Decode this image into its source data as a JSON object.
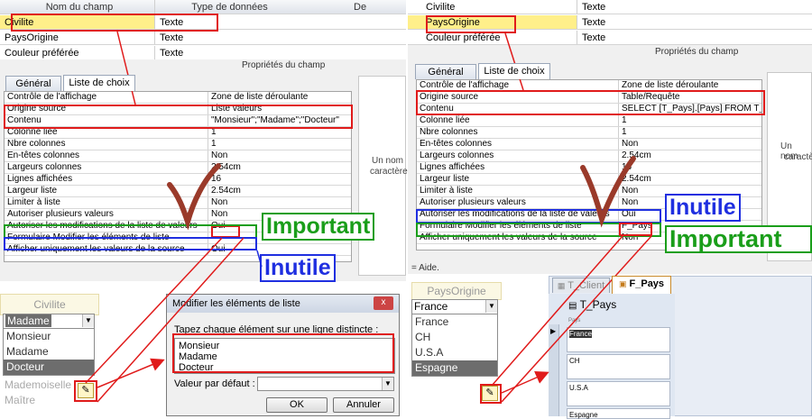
{
  "left_top": {
    "col1": "Nom du champ",
    "col2": "Type de données",
    "col3": "De",
    "rows": [
      {
        "name": "Civilite",
        "type": "Texte"
      },
      {
        "name": "PaysOrigine",
        "type": "Texte"
      },
      {
        "name": "Couleur préférée",
        "type": "Texte"
      }
    ]
  },
  "right_top": {
    "rows": [
      {
        "name": "Civilite",
        "type": "Texte"
      },
      {
        "name": "PaysOrigine",
        "type": "Texte"
      },
      {
        "name": "Couleur préférée",
        "type": "Texte"
      }
    ]
  },
  "props_title": "Propriétés du champ",
  "tabs": {
    "general": "Général",
    "liste": "Liste de choix"
  },
  "left_props": [
    {
      "name": "Contrôle de l'affichage",
      "value": "Zone de liste déroulante"
    },
    {
      "name": "Origine source",
      "value": "Liste valeurs"
    },
    {
      "name": "Contenu",
      "value": "\"Monsieur\";\"Madame\";\"Docteur\""
    },
    {
      "name": "Colonne liée",
      "value": "1"
    },
    {
      "name": "Nbre colonnes",
      "value": "1"
    },
    {
      "name": "En-têtes colonnes",
      "value": "Non"
    },
    {
      "name": "Largeurs colonnes",
      "value": "2.54cm"
    },
    {
      "name": "Lignes affichées",
      "value": "16"
    },
    {
      "name": "Largeur liste",
      "value": "2.54cm"
    },
    {
      "name": "Limiter à liste",
      "value": "Non"
    },
    {
      "name": "Autoriser plusieurs valeurs",
      "value": "Non"
    },
    {
      "name": "Autoriser les modifications de la liste de valeurs",
      "value": "Oui"
    },
    {
      "name": "Formulaire Modifier les éléments de liste",
      "value": ""
    },
    {
      "name": "Afficher uniquement les valeurs de la source",
      "value": "Oui"
    }
  ],
  "right_props": [
    {
      "name": "Contrôle de l'affichage",
      "value": "Zone de liste déroulante"
    },
    {
      "name": "Origine source",
      "value": "Table/Requête"
    },
    {
      "name": "Contenu",
      "value": "SELECT [T_Pays].[Pays] FROM T_Pay"
    },
    {
      "name": "Colonne liée",
      "value": "1"
    },
    {
      "name": "Nbre colonnes",
      "value": "1"
    },
    {
      "name": "En-têtes colonnes",
      "value": "Non"
    },
    {
      "name": "Largeurs colonnes",
      "value": "2.54cm"
    },
    {
      "name": "Lignes affichées",
      "value": "16"
    },
    {
      "name": "Largeur liste",
      "value": "2.54cm"
    },
    {
      "name": "Limiter à liste",
      "value": "Non"
    },
    {
      "name": "Autoriser plusieurs valeurs",
      "value": "Non"
    },
    {
      "name": "Autoriser les modifications de la liste de valeurs",
      "value": "Oui"
    },
    {
      "name": "Formulaire Modifier les éléments de liste",
      "value": "F_Pays"
    },
    {
      "name": "Afficher uniquement les valeurs de la source",
      "value": "Non"
    }
  ],
  "side_hint": {
    "line1": "Un nom",
    "line2": "caractère"
  },
  "aide": "= Aide.",
  "labels": {
    "important": "Important",
    "inutile": "Inutile"
  },
  "civ_form": {
    "header": "Civilite",
    "combo_value": "Madame",
    "options": [
      "Monsieur",
      "Madame",
      "Docteur"
    ],
    "extra": [
      "Mademoiselle",
      "Maître"
    ]
  },
  "dialog": {
    "title": "Modifier les éléments de liste",
    "instruction": "Tapez chaque élément sur une ligne distincte :",
    "items": [
      "Monsieur",
      "Madame",
      "Docteur"
    ],
    "default_label": "Valeur par défaut :",
    "ok": "OK",
    "cancel": "Annuler",
    "close": "x"
  },
  "pays_form": {
    "header": "PaysOrigine",
    "combo_value": "France",
    "options": [
      "France",
      "CH",
      "U.S.A",
      "Espagne"
    ]
  },
  "fpays": {
    "tab1": "T_Client",
    "tab2": "F_Pays",
    "title": "T_Pays",
    "col": "Pays",
    "records": [
      "France",
      "CH",
      "U.S.A",
      "Espagne"
    ]
  },
  "colors": {
    "red": "#e01b1b",
    "blue": "#1f2fe0",
    "green": "#1a9e1a",
    "access_tab": "#e0a040"
  }
}
